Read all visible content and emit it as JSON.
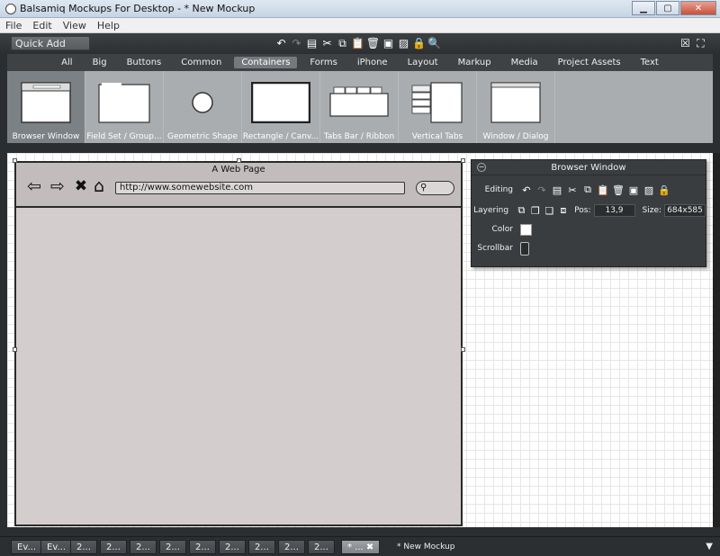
{
  "window": {
    "title": "Balsamiq Mockups For Desktop - * New Mockup",
    "min": "▁",
    "max": "▢",
    "close": "✕"
  },
  "menu": [
    "File",
    "Edit",
    "View",
    "Help"
  ],
  "toolbar": {
    "quick_add_placeholder": "Quick Add",
    "tools": [
      "undo-icon",
      "redo-icon",
      "duplicate-icon",
      "cut-icon",
      "copy-icon",
      "paste-icon",
      "delete-icon",
      "group-icon",
      "ungroup-icon",
      "lock-icon",
      "search-icon"
    ],
    "right_tools": [
      "close-mockup-icon",
      "fullscreen-icon"
    ]
  },
  "filters": {
    "items": [
      "All",
      "Big",
      "Buttons",
      "Common",
      "Containers",
      "Forms",
      "iPhone",
      "Layout",
      "Markup",
      "Media",
      "Project Assets",
      "Text"
    ],
    "active": "Containers"
  },
  "library": {
    "items": [
      "Browser Window",
      "Field Set / Group...",
      "Geometric Shape",
      "Rectangle / Canv...",
      "Tabs Bar / Ribbon",
      "Vertical Tabs",
      "Window / Dialog"
    ],
    "selected": "Browser Window"
  },
  "browser_window": {
    "title": "A Web Page",
    "url": "http://www.somewebsite.com"
  },
  "inspector": {
    "title": "Browser Window",
    "editing_label": "Editing",
    "layering_label": "Layering",
    "pos_label": "Pos:",
    "pos_value": "13,9",
    "size_label": "Size:",
    "size_value": "684x585",
    "color_label": "Color",
    "color_value": "#ffffff",
    "scrollbar_label": "Scrollbar"
  },
  "bottom": {
    "tabs": [
      "Ev...",
      "Ev...",
      "2...",
      "2...",
      "2...",
      "2...",
      "2...",
      "2...",
      "2...",
      "2...",
      "2..."
    ],
    "active_tab": "* ...",
    "mockup_name": "* New Mockup"
  }
}
